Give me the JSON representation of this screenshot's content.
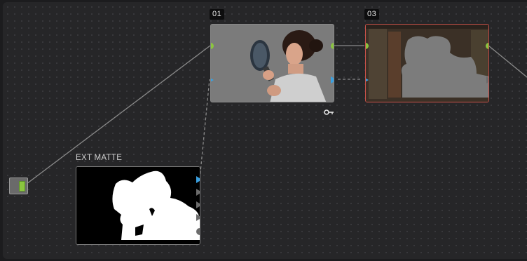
{
  "nodes": {
    "node01": {
      "label": "01"
    },
    "node03": {
      "label": "03"
    },
    "ext_matte": {
      "label": "EXT MATTE"
    }
  },
  "colors": {
    "canvas": "#262628",
    "connector_rgb": "#8bc53f",
    "connector_key": "#3aa0e0",
    "connector_unused": "#6b6b6b",
    "selected_border": "#c9524a"
  },
  "icons": [
    "key-icon"
  ]
}
